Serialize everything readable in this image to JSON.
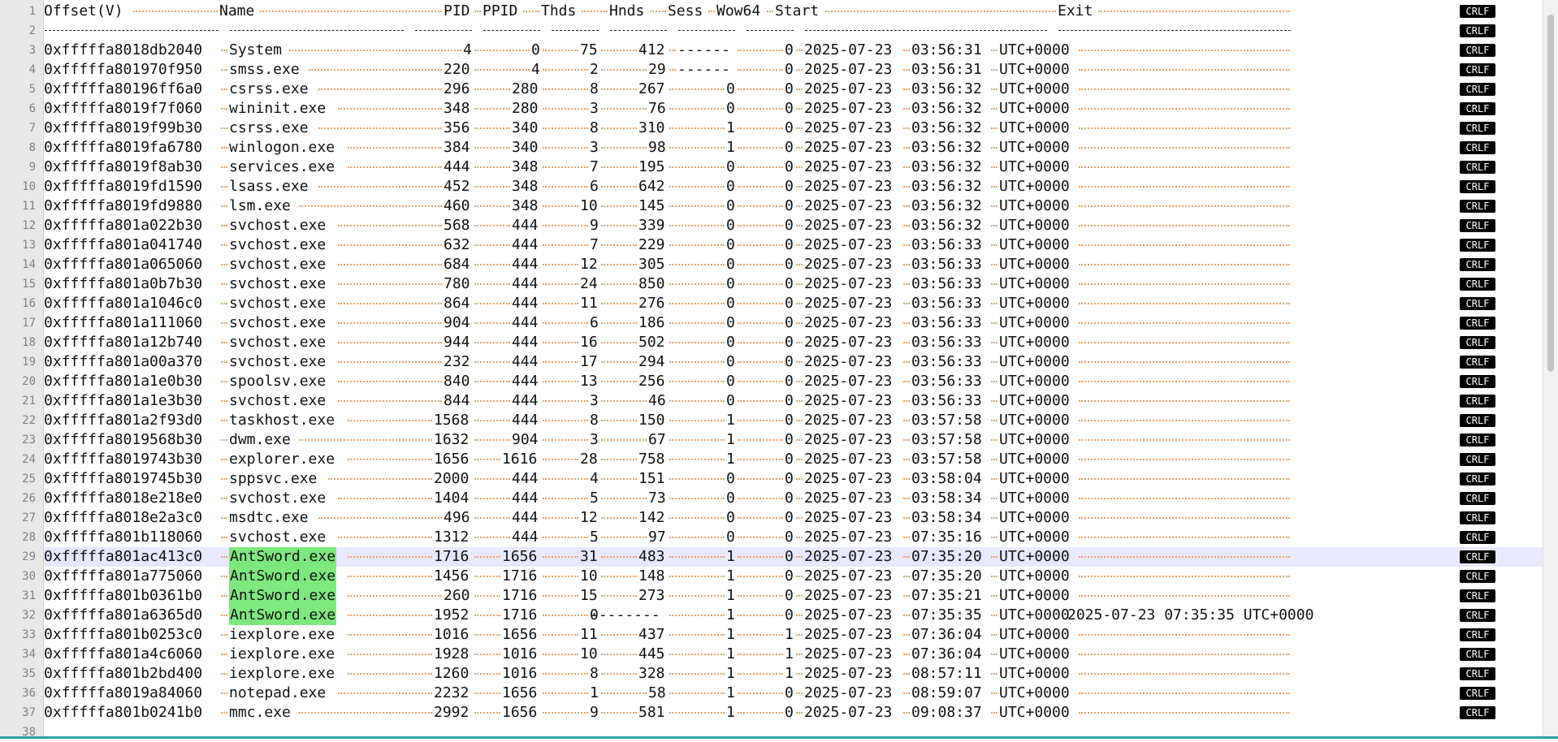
{
  "editor": {
    "header": {
      "offset": "Offset(V)",
      "name": "Name",
      "pid": "PID",
      "ppid": "PPID",
      "thds": "Thds",
      "hnds": "Hnds",
      "sess": "Sess",
      "wow64": "Wow64",
      "start": "Start",
      "exit": "Exit"
    },
    "eol_marker": "CRLF",
    "processes": [
      {
        "offset": "0xfffffa8018db2040",
        "name": "System",
        "pid": "4",
        "ppid": "0",
        "thds": "75",
        "hnds": "412",
        "sess": "------",
        "wow64": "0",
        "start_date": "2025-07-23",
        "start_time": "03:56:31",
        "start_tz": "UTC+0000"
      },
      {
        "offset": "0xfffffa801970f950",
        "name": "smss.exe",
        "pid": "220",
        "ppid": "4",
        "thds": "2",
        "hnds": "29",
        "sess": "------",
        "wow64": "0",
        "start_date": "2025-07-23",
        "start_time": "03:56:31",
        "start_tz": "UTC+0000"
      },
      {
        "offset": "0xfffffa80196ff6a0",
        "name": "csrss.exe",
        "pid": "296",
        "ppid": "280",
        "thds": "8",
        "hnds": "267",
        "sess": "0",
        "wow64": "0",
        "start_date": "2025-07-23",
        "start_time": "03:56:32",
        "start_tz": "UTC+0000"
      },
      {
        "offset": "0xfffffa8019f7f060",
        "name": "wininit.exe",
        "pid": "348",
        "ppid": "280",
        "thds": "3",
        "hnds": "76",
        "sess": "0",
        "wow64": "0",
        "start_date": "2025-07-23",
        "start_time": "03:56:32",
        "start_tz": "UTC+0000"
      },
      {
        "offset": "0xfffffa8019f99b30",
        "name": "csrss.exe",
        "pid": "356",
        "ppid": "340",
        "thds": "8",
        "hnds": "310",
        "sess": "1",
        "wow64": "0",
        "start_date": "2025-07-23",
        "start_time": "03:56:32",
        "start_tz": "UTC+0000"
      },
      {
        "offset": "0xfffffa8019fa6780",
        "name": "winlogon.exe",
        "pid": "384",
        "ppid": "340",
        "thds": "3",
        "hnds": "98",
        "sess": "1",
        "wow64": "0",
        "start_date": "2025-07-23",
        "start_time": "03:56:32",
        "start_tz": "UTC+0000"
      },
      {
        "offset": "0xfffffa8019f8ab30",
        "name": "services.exe",
        "pid": "444",
        "ppid": "348",
        "thds": "7",
        "hnds": "195",
        "sess": "0",
        "wow64": "0",
        "start_date": "2025-07-23",
        "start_time": "03:56:32",
        "start_tz": "UTC+0000"
      },
      {
        "offset": "0xfffffa8019fd1590",
        "name": "lsass.exe",
        "pid": "452",
        "ppid": "348",
        "thds": "6",
        "hnds": "642",
        "sess": "0",
        "wow64": "0",
        "start_date": "2025-07-23",
        "start_time": "03:56:32",
        "start_tz": "UTC+0000"
      },
      {
        "offset": "0xfffffa8019fd9880",
        "name": "lsm.exe",
        "pid": "460",
        "ppid": "348",
        "thds": "10",
        "hnds": "145",
        "sess": "0",
        "wow64": "0",
        "start_date": "2025-07-23",
        "start_time": "03:56:32",
        "start_tz": "UTC+0000"
      },
      {
        "offset": "0xfffffa801a022b30",
        "name": "svchost.exe",
        "pid": "568",
        "ppid": "444",
        "thds": "9",
        "hnds": "339",
        "sess": "0",
        "wow64": "0",
        "start_date": "2025-07-23",
        "start_time": "03:56:32",
        "start_tz": "UTC+0000"
      },
      {
        "offset": "0xfffffa801a041740",
        "name": "svchost.exe",
        "pid": "632",
        "ppid": "444",
        "thds": "7",
        "hnds": "229",
        "sess": "0",
        "wow64": "0",
        "start_date": "2025-07-23",
        "start_time": "03:56:33",
        "start_tz": "UTC+0000"
      },
      {
        "offset": "0xfffffa801a065060",
        "name": "svchost.exe",
        "pid": "684",
        "ppid": "444",
        "thds": "12",
        "hnds": "305",
        "sess": "0",
        "wow64": "0",
        "start_date": "2025-07-23",
        "start_time": "03:56:33",
        "start_tz": "UTC+0000"
      },
      {
        "offset": "0xfffffa801a0b7b30",
        "name": "svchost.exe",
        "pid": "780",
        "ppid": "444",
        "thds": "24",
        "hnds": "850",
        "sess": "0",
        "wow64": "0",
        "start_date": "2025-07-23",
        "start_time": "03:56:33",
        "start_tz": "UTC+0000"
      },
      {
        "offset": "0xfffffa801a1046c0",
        "name": "svchost.exe",
        "pid": "864",
        "ppid": "444",
        "thds": "11",
        "hnds": "276",
        "sess": "0",
        "wow64": "0",
        "start_date": "2025-07-23",
        "start_time": "03:56:33",
        "start_tz": "UTC+0000"
      },
      {
        "offset": "0xfffffa801a111060",
        "name": "svchost.exe",
        "pid": "904",
        "ppid": "444",
        "thds": "6",
        "hnds": "186",
        "sess": "0",
        "wow64": "0",
        "start_date": "2025-07-23",
        "start_time": "03:56:33",
        "start_tz": "UTC+0000"
      },
      {
        "offset": "0xfffffa801a12b740",
        "name": "svchost.exe",
        "pid": "944",
        "ppid": "444",
        "thds": "16",
        "hnds": "502",
        "sess": "0",
        "wow64": "0",
        "start_date": "2025-07-23",
        "start_time": "03:56:33",
        "start_tz": "UTC+0000"
      },
      {
        "offset": "0xfffffa801a00a370",
        "name": "svchost.exe",
        "pid": "232",
        "ppid": "444",
        "thds": "17",
        "hnds": "294",
        "sess": "0",
        "wow64": "0",
        "start_date": "2025-07-23",
        "start_time": "03:56:33",
        "start_tz": "UTC+0000"
      },
      {
        "offset": "0xfffffa801a1e0b30",
        "name": "spoolsv.exe",
        "pid": "840",
        "ppid": "444",
        "thds": "13",
        "hnds": "256",
        "sess": "0",
        "wow64": "0",
        "start_date": "2025-07-23",
        "start_time": "03:56:33",
        "start_tz": "UTC+0000"
      },
      {
        "offset": "0xfffffa801a1e3b30",
        "name": "svchost.exe",
        "pid": "844",
        "ppid": "444",
        "thds": "3",
        "hnds": "46",
        "sess": "0",
        "wow64": "0",
        "start_date": "2025-07-23",
        "start_time": "03:56:33",
        "start_tz": "UTC+0000"
      },
      {
        "offset": "0xfffffa801a2f93d0",
        "name": "taskhost.exe",
        "pid": "1568",
        "ppid": "444",
        "thds": "8",
        "hnds": "150",
        "sess": "1",
        "wow64": "0",
        "start_date": "2025-07-23",
        "start_time": "03:57:58",
        "start_tz": "UTC+0000"
      },
      {
        "offset": "0xfffffa8019568b30",
        "name": "dwm.exe",
        "pid": "1632",
        "ppid": "904",
        "thds": "3",
        "hnds": "67",
        "sess": "1",
        "wow64": "0",
        "start_date": "2025-07-23",
        "start_time": "03:57:58",
        "start_tz": "UTC+0000"
      },
      {
        "offset": "0xfffffa8019743b30",
        "name": "explorer.exe",
        "pid": "1656",
        "ppid": "1616",
        "thds": "28",
        "hnds": "758",
        "sess": "1",
        "wow64": "0",
        "start_date": "2025-07-23",
        "start_time": "03:57:58",
        "start_tz": "UTC+0000"
      },
      {
        "offset": "0xfffffa8019745b30",
        "name": "sppsvc.exe",
        "pid": "2000",
        "ppid": "444",
        "thds": "4",
        "hnds": "151",
        "sess": "0",
        "wow64": "0",
        "start_date": "2025-07-23",
        "start_time": "03:58:04",
        "start_tz": "UTC+0000"
      },
      {
        "offset": "0xfffffa8018e218e0",
        "name": "svchost.exe",
        "pid": "1404",
        "ppid": "444",
        "thds": "5",
        "hnds": "73",
        "sess": "0",
        "wow64": "0",
        "start_date": "2025-07-23",
        "start_time": "03:58:34",
        "start_tz": "UTC+0000"
      },
      {
        "offset": "0xfffffa8018e2a3c0",
        "name": "msdtc.exe",
        "pid": "496",
        "ppid": "444",
        "thds": "12",
        "hnds": "142",
        "sess": "0",
        "wow64": "0",
        "start_date": "2025-07-23",
        "start_time": "03:58:34",
        "start_tz": "UTC+0000"
      },
      {
        "offset": "0xfffffa801b118060",
        "name": "svchost.exe",
        "pid": "1312",
        "ppid": "444",
        "thds": "5",
        "hnds": "97",
        "sess": "0",
        "wow64": "0",
        "start_date": "2025-07-23",
        "start_time": "07:35:16",
        "start_tz": "UTC+0000"
      },
      {
        "offset": "0xfffffa801ac413c0",
        "name": "AntSword.exe",
        "pid": "1716",
        "ppid": "1656",
        "thds": "31",
        "hnds": "483",
        "sess": "1",
        "wow64": "0",
        "start_date": "2025-07-23",
        "start_time": "07:35:20",
        "start_tz": "UTC+0000",
        "highlight": true,
        "current": true
      },
      {
        "offset": "0xfffffa801a775060",
        "name": "AntSword.exe",
        "pid": "1456",
        "ppid": "1716",
        "thds": "10",
        "hnds": "148",
        "sess": "1",
        "wow64": "0",
        "start_date": "2025-07-23",
        "start_time": "07:35:20",
        "start_tz": "UTC+0000",
        "highlight": true
      },
      {
        "offset": "0xfffffa801b0361b0",
        "name": "AntSword.exe",
        "pid": "260",
        "ppid": "1716",
        "thds": "15",
        "hnds": "273",
        "sess": "1",
        "wow64": "0",
        "start_date": "2025-07-23",
        "start_time": "07:35:21",
        "start_tz": "UTC+0000",
        "highlight": true
      },
      {
        "offset": "0xfffffa801a6365d0",
        "name": "AntSword.exe",
        "pid": "1952",
        "ppid": "1716",
        "thds": "0",
        "hnds": "--------",
        "sess": "1",
        "wow64": "0",
        "start_date": "2025-07-23",
        "start_time": "07:35:35",
        "start_tz": "UTC+0000",
        "highlight": true,
        "exit": "2025-07-23 07:35:35 UTC+0000"
      },
      {
        "offset": "0xfffffa801b0253c0",
        "name": "iexplore.exe",
        "pid": "1016",
        "ppid": "1656",
        "thds": "11",
        "hnds": "437",
        "sess": "1",
        "wow64": "1",
        "start_date": "2025-07-23",
        "start_time": "07:36:04",
        "start_tz": "UTC+0000"
      },
      {
        "offset": "0xfffffa801a4c6060",
        "name": "iexplore.exe",
        "pid": "1928",
        "ppid": "1016",
        "thds": "10",
        "hnds": "445",
        "sess": "1",
        "wow64": "1",
        "start_date": "2025-07-23",
        "start_time": "07:36:04",
        "start_tz": "UTC+0000"
      },
      {
        "offset": "0xfffffa801b2bd400",
        "name": "iexplore.exe",
        "pid": "1260",
        "ppid": "1016",
        "thds": "8",
        "hnds": "328",
        "sess": "1",
        "wow64": "1",
        "start_date": "2025-07-23",
        "start_time": "08:57:11",
        "start_tz": "UTC+0000"
      },
      {
        "offset": "0xfffffa8019a84060",
        "name": "notepad.exe",
        "pid": "2232",
        "ppid": "1656",
        "thds": "1",
        "hnds": "58",
        "sess": "1",
        "wow64": "0",
        "start_date": "2025-07-23",
        "start_time": "08:59:07",
        "start_tz": "UTC+0000"
      },
      {
        "offset": "0xfffffa801b0241b0",
        "name": "mmc.exe",
        "pid": "2992",
        "ppid": "1656",
        "thds": "9",
        "hnds": "581",
        "sess": "1",
        "wow64": "0",
        "start_date": "2025-07-23",
        "start_time": "09:08:37",
        "start_tz": "UTC+0000"
      }
    ],
    "highlight_color": "#7ee87e",
    "current_line_color": "#e8e8ff",
    "whitespace_dot_color": "#f0a060"
  }
}
